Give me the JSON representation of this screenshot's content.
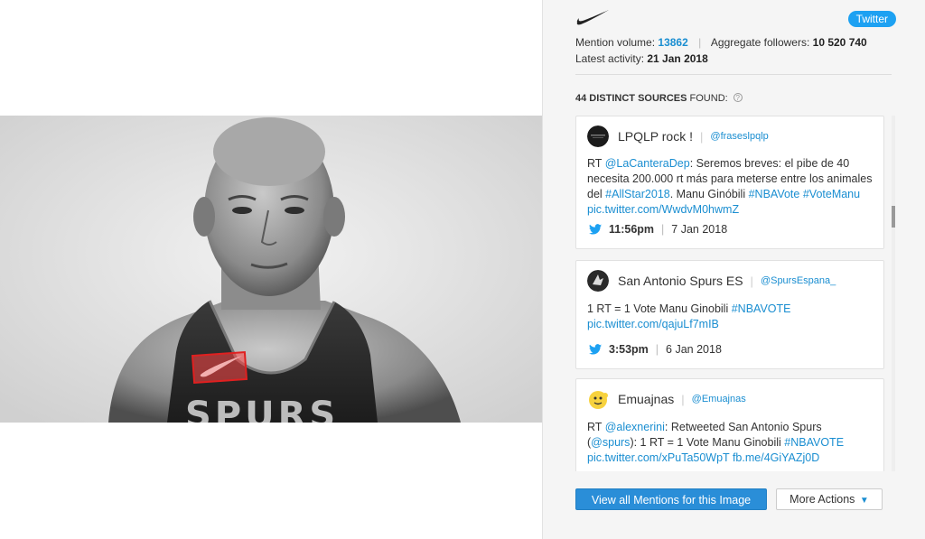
{
  "badge": "Twitter",
  "meta": {
    "mention_label": "Mention volume:",
    "mention_value": "13862",
    "followers_label": "Aggregate followers:",
    "followers_value": "10 520 740",
    "activity_label": "Latest activity:",
    "activity_value": "21 Jan 2018"
  },
  "sources": {
    "count": "44 DISTINCT SOURCES",
    "suffix": "FOUND:",
    "info": "?"
  },
  "mentions": [
    {
      "name": "LPQLP rock !",
      "handle": "@fraseslpqlp",
      "body": [
        {
          "t": "RT ",
          "link": false
        },
        {
          "t": "@LaCanteraDep",
          "link": true
        },
        {
          "t": ": Seremos breves: el pibe de 40 necesita 200.000 rt más para meterse entre los animales del ",
          "link": false
        },
        {
          "t": "#AllStar2018",
          "link": true
        },
        {
          "t": ". Manu Ginóbili ",
          "link": false
        },
        {
          "t": "#NBAVote",
          "link": true
        },
        {
          "t": " ",
          "link": false
        },
        {
          "t": "#VoteManu",
          "link": true
        },
        {
          "t": " ",
          "link": false
        },
        {
          "t": "pic.twitter.com/WwdvM0hwmZ",
          "link": true
        }
      ],
      "time": "11:56pm",
      "date": "7 Jan 2018",
      "avatar": "dark"
    },
    {
      "name": "San Antonio Spurs ES",
      "handle": "@SpursEspana_",
      "body": [
        {
          "t": "1 RT = 1 Vote Manu Ginobili ",
          "link": false
        },
        {
          "t": "#NBAVOTE",
          "link": true
        },
        {
          "t": " ",
          "link": false
        },
        {
          "t": "pic.twitter.com/qajuLf7mIB",
          "link": true
        }
      ],
      "time": "3:53pm",
      "date": "6 Jan 2018",
      "avatar": "spurs"
    },
    {
      "name": "Emuajnas",
      "handle": "@Emuajnas",
      "body": [
        {
          "t": "RT ",
          "link": false
        },
        {
          "t": "@alexnerini",
          "link": true
        },
        {
          "t": ": Retweeted San Antonio Spurs (",
          "link": false
        },
        {
          "t": "@spurs",
          "link": true
        },
        {
          "t": "): 1 RT = 1 Vote Manu Ginobili ",
          "link": false
        },
        {
          "t": "#NBAVOTE",
          "link": true
        },
        {
          "t": " ",
          "link": false
        },
        {
          "t": "pic.twitter.com/xPuTa50WpT",
          "link": true
        },
        {
          "t": " ",
          "link": false
        },
        {
          "t": "fb.me/4GiYAZj0D",
          "link": true
        }
      ],
      "time": "",
      "date": "",
      "avatar": "emoji"
    }
  ],
  "buttons": {
    "view_all": "View all Mentions for this Image",
    "more_actions": "More Actions"
  },
  "colors": {
    "accent": "#1a8ed1",
    "twitter": "#1da1f2",
    "primary_button": "#2a8ed8",
    "highlight_box": "#e02020"
  }
}
